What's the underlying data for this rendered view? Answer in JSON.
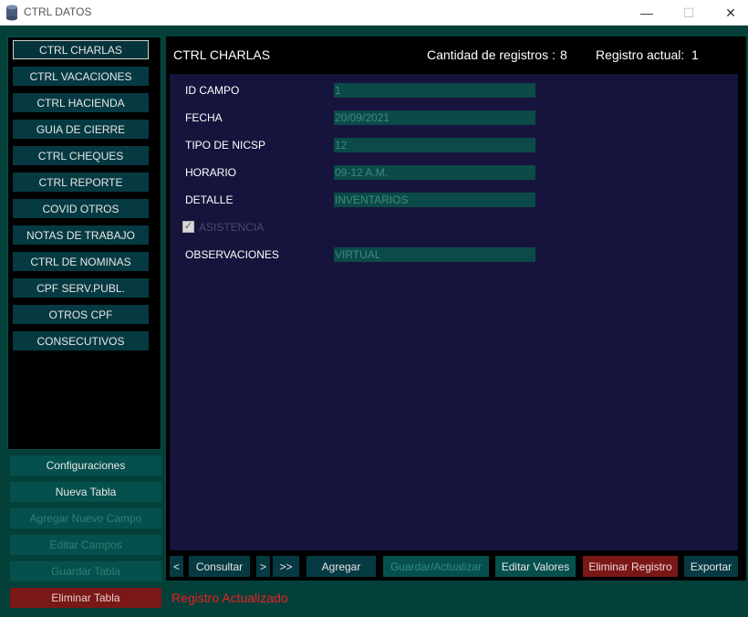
{
  "window": {
    "title": "CTRL DATOS",
    "minimize_glyph": "—",
    "maximize_glyph": "☐",
    "close_glyph": "✕"
  },
  "sidebar": {
    "items": [
      {
        "label": "CTRL CHARLAS",
        "active": true
      },
      {
        "label": "CTRL VACACIONES"
      },
      {
        "label": "CTRL HACIENDA"
      },
      {
        "label": "GUIA DE CIERRE"
      },
      {
        "label": "CTRL CHEQUES"
      },
      {
        "label": "CTRL REPORTE"
      },
      {
        "label": "COVID OTROS"
      },
      {
        "label": "NOTAS DE TRABAJO"
      },
      {
        "label": "CTRL DE NOMINAS"
      },
      {
        "label": "CPF SERV.PUBL."
      },
      {
        "label": "OTROS CPF"
      },
      {
        "label": "CONSECUTIVOS"
      }
    ]
  },
  "bottom_menu": {
    "configuraciones": "Configuraciones",
    "nueva_tabla": "Nueva Tabla",
    "agregar_campo": "Agregar Nuevo Campo",
    "editar_campos": "Editar Campos",
    "guardar_tabla": "Guardar Tabla",
    "eliminar_tabla": "Eliminar Tabla"
  },
  "header": {
    "title": "CTRL CHARLAS",
    "count_label": "Cantidad de registros :",
    "count_value": "8",
    "current_label": "Registro actual:",
    "current_value": "1"
  },
  "form": {
    "fields": [
      {
        "label": "ID CAMPO",
        "value": "1"
      },
      {
        "label": "FECHA",
        "value": "20/09/2021"
      },
      {
        "label": "TIPO DE NICSP",
        "value": "12"
      },
      {
        "label": "HORARIO",
        "value": "09-12 A.M."
      },
      {
        "label": "DETALLE",
        "value": "INVENTARIOS"
      }
    ],
    "checkbox": {
      "label": "ASISTENCIA",
      "checked": true,
      "glyph": "✓"
    },
    "observaciones": {
      "label": "OBSERVACIONES",
      "value": "VIRTUAL"
    }
  },
  "actions": {
    "prev": "<",
    "consultar": "Consultar",
    "next": ">",
    "last": ">>",
    "agregar": "Agregar",
    "guardar": "Guardar/Actualizar",
    "editar": "Editar Valores",
    "eliminar": "Eliminar Registro",
    "exportar": "Exportar"
  },
  "status": "Registro Actualizado",
  "colors": {
    "background": "#04403a",
    "panel": "#16143c",
    "button": "#063a42",
    "danger": "#7a1717",
    "status_text": "#e82020"
  }
}
